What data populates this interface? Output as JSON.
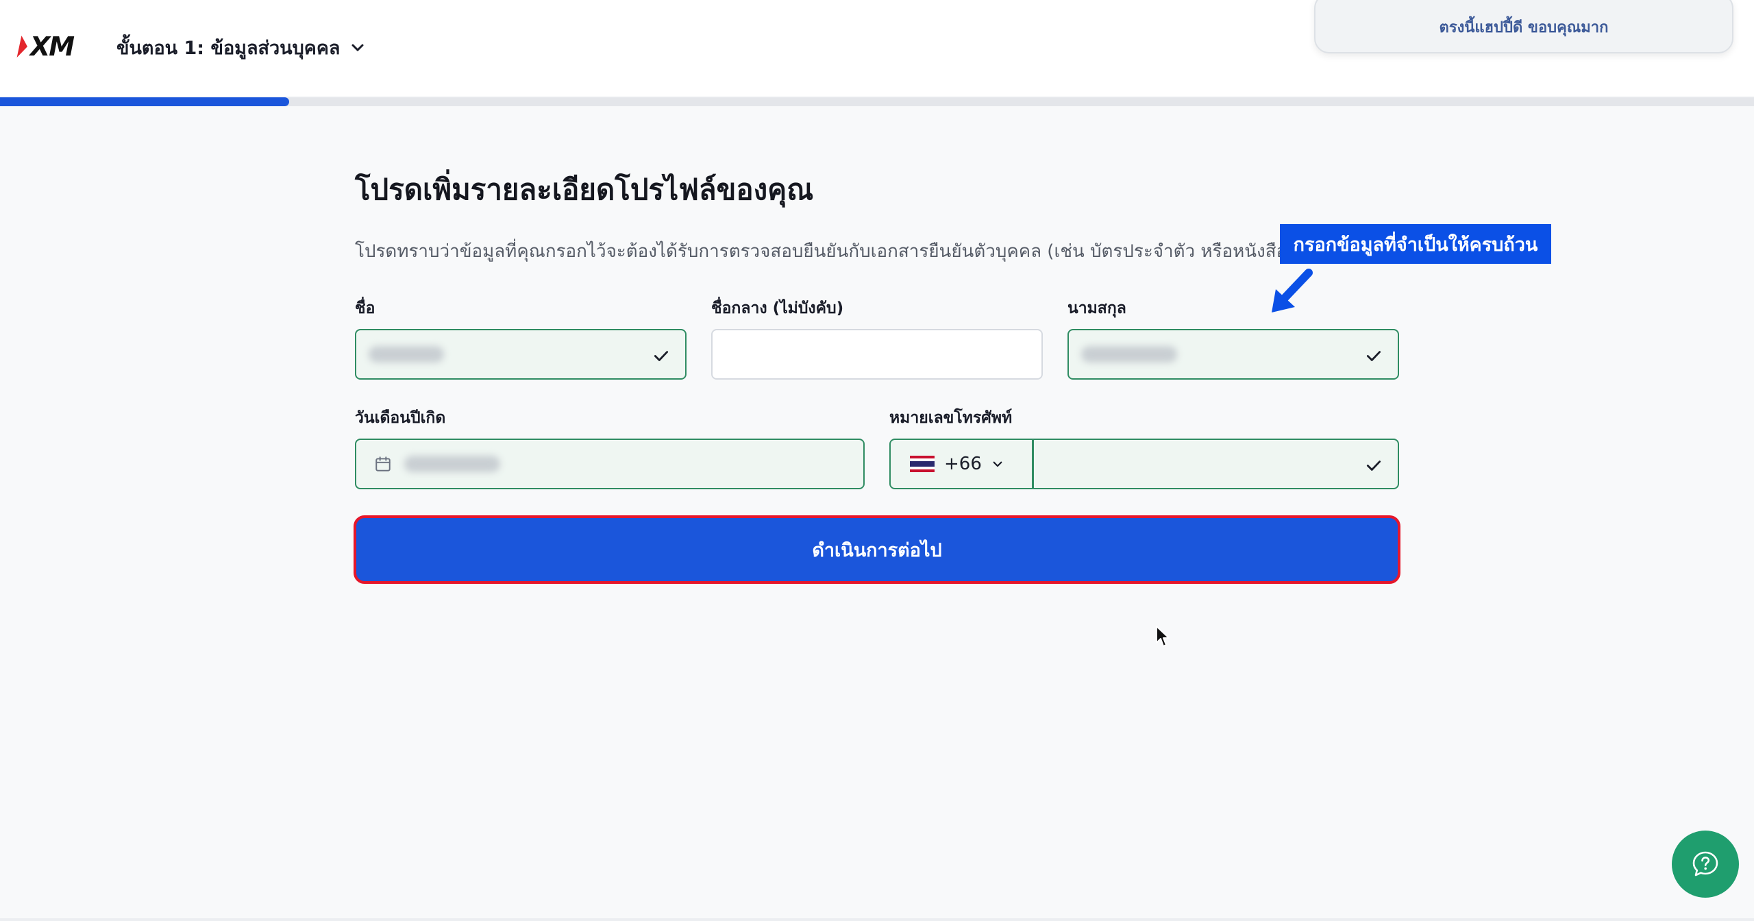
{
  "header": {
    "logo_text": "XM",
    "step_label": "ขั้นตอน 1: ข้อมูลส่วนบุคคล",
    "progress_fraction": 0.165
  },
  "toast": {
    "text": "ตรงนี้แฮปปี้ดี ขอบคุณมาก"
  },
  "form": {
    "title": "โปรดเพิ่มรายละเอียดโปรไฟล์ของคุณ",
    "subtitle": "โปรดทราบว่าข้อมูลที่คุณกรอกไว้จะต้องได้รับการตรวจสอบยืนยันกับเอกสารยืนยันตัวบุคคล (เช่น บัตรประจำตัว หรือหนังสือเดินทาง)",
    "first_name_label": "ชื่อ",
    "middle_name_label": "ชื่อกลาง (ไม่บังคับ)",
    "last_name_label": "นามสกุล",
    "dob_label": "วันเดือนปีเกิด",
    "phone_label": "หมายเลขโทรศัพท์",
    "country_code": "+66",
    "continue_label": "ดำเนินการต่อไป"
  },
  "annotation": {
    "callout_text": "กรอกข้อมูลที่จำเป็นให้ครบถ้วน"
  },
  "colors": {
    "primary": "#1b56db",
    "valid_border": "#2f8c62",
    "valid_bg": "#eff6f2",
    "highlight_red": "#e5172b",
    "callout_blue": "#0b50e6",
    "help_green": "#1f9e6e"
  },
  "icons": {
    "step_dropdown": "chevron-down-icon",
    "valid": "check-icon",
    "date": "calendar-icon",
    "flag": "thailand-flag-icon",
    "help": "question-icon"
  }
}
